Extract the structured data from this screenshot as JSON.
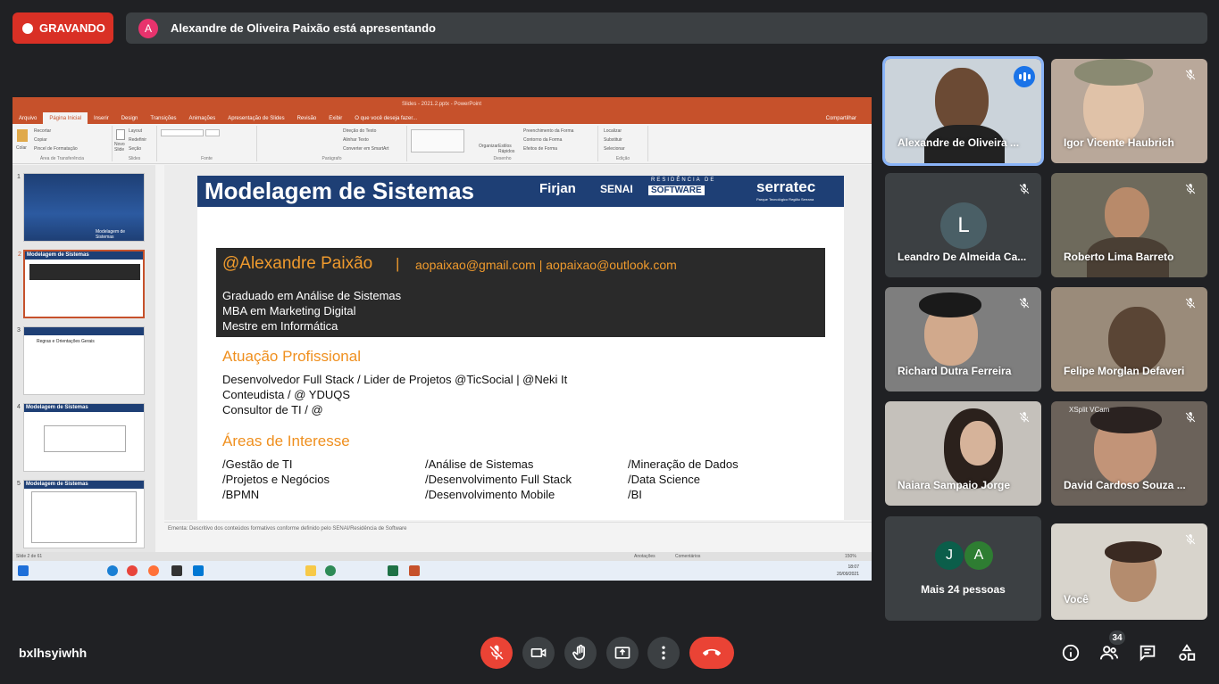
{
  "recording": {
    "label": "GRAVANDO",
    "color": "#d93025"
  },
  "presenting": {
    "avatar_letter": "A",
    "text": "Alexandre de Oliveira Paixão está apresentando"
  },
  "screen": {
    "window_title": "Slides - 2021.2.pptx - PowerPoint",
    "tabs": [
      "Arquivo",
      "Página Inicial",
      "Inserir",
      "Design",
      "Transições",
      "Animações",
      "Apresentação de Slides",
      "Revisão",
      "Exibir",
      "O que você deseja fazer..."
    ],
    "share": "Compartilhar",
    "ribbon": {
      "clipboard": [
        "Recortar",
        "Copiar",
        "Pincel de Formatação"
      ],
      "paste": "Colar",
      "slides": [
        "Layout",
        "Redefinir",
        "Seção"
      ],
      "new_slide": "Novo Slide",
      "paragraph": [
        "Direção do Texto",
        "Alinhar Texto",
        "Converter em SmartArt"
      ],
      "drawing": [
        "Preenchimento da Forma",
        "Contorno da Forma",
        "Efeitos de Forma"
      ],
      "arrange": "Organizar",
      "quick_styles": "Estilos Rápidos",
      "editing": [
        "Localizar",
        "Substituir",
        "Selecionar"
      ],
      "groups": [
        "Área de Transferência",
        "Slides",
        "Fonte",
        "Parágrafo",
        "Desenho",
        "Edição"
      ]
    },
    "thumbnails": [
      {
        "n": "1",
        "title": "Modelagem de Sistemas"
      },
      {
        "n": "2",
        "title": "Modelagem de Sistemas"
      },
      {
        "n": "3",
        "title": "Regras e Orientações Gerais"
      },
      {
        "n": "4",
        "title": "Modelagem de Sistemas"
      },
      {
        "n": "5",
        "title": "Modelagem de Sistemas"
      }
    ],
    "slide": {
      "title": "Modelagem de Sistemas",
      "logos": [
        "Firjan",
        "SENAI",
        "RESIDÊNCIA DE",
        "SOFTWARE",
        "serratec",
        "Parque Tecnológico Região Serrana"
      ],
      "name": "@Alexandre Paixão",
      "separator": "|",
      "emails": "aopaixao@gmail.com  | aopaixao@outlook.com",
      "degrees": [
        "Graduado em Análise de Sistemas",
        "MBA em Marketing Digital",
        "Mestre em Informática"
      ],
      "atuacao_title": "Atuação Profissional",
      "atuacao": [
        "Desenvolvedor Full Stack / Lider de Projetos @TicSocial | @Neki It",
        "Conteudista / @ YDUQS",
        "Consultor de TI / @"
      ],
      "areas_title": "Áreas de Interesse",
      "areas_col1": [
        "/Gestão de TI",
        "/Projetos e Negócios",
        "/BPMN"
      ],
      "areas_col2": [
        "/Análise de Sistemas",
        "/Desenvolvimento Full Stack",
        "/Desenvolvimento Mobile"
      ],
      "areas_col3": [
        "/Mineração de Dados",
        "/Data Science",
        "/BI"
      ]
    },
    "notes": "Ementa: Descritivo dos conteúdos formativos conforme definido pelo SENAI/Residência de Software",
    "status": {
      "slide": "Slide 2 de 61",
      "notes_btn": "Anotações",
      "comments_btn": "Comentários",
      "zoom": "150%"
    },
    "clock": {
      "time": "18:07",
      "date": "20/09/2021"
    }
  },
  "participants": [
    {
      "name": "Alexandre de Oliveira ...",
      "speaking": true
    },
    {
      "name": "Igor Vicente Haubrich",
      "muted": true
    },
    {
      "name": "Leandro De Almeida Ca...",
      "muted": true,
      "avatar": "L"
    },
    {
      "name": "Roberto Lima Barreto",
      "muted": true
    },
    {
      "name": "Richard Dutra Ferreira",
      "muted": true
    },
    {
      "name": "Felipe Morglan Defaveri",
      "muted": true
    },
    {
      "name": "Naiara Sampaio Jorge",
      "muted": true
    },
    {
      "name": "David Cardoso Souza ...",
      "muted": true,
      "overlay": "XSplit VCam"
    },
    {
      "name": "Mais 24 pessoas",
      "avatars": [
        "J",
        "A"
      ]
    },
    {
      "name": "Você",
      "muted": true
    }
  ],
  "bottom": {
    "meeting_code": "bxlhsyiwhh",
    "people_count": "34"
  },
  "icons": [
    "mic-off-icon",
    "camera-icon",
    "hand-icon",
    "present-icon",
    "more-icon",
    "end-call-icon",
    "info-icon",
    "people-icon",
    "chat-icon",
    "activities-icon"
  ]
}
